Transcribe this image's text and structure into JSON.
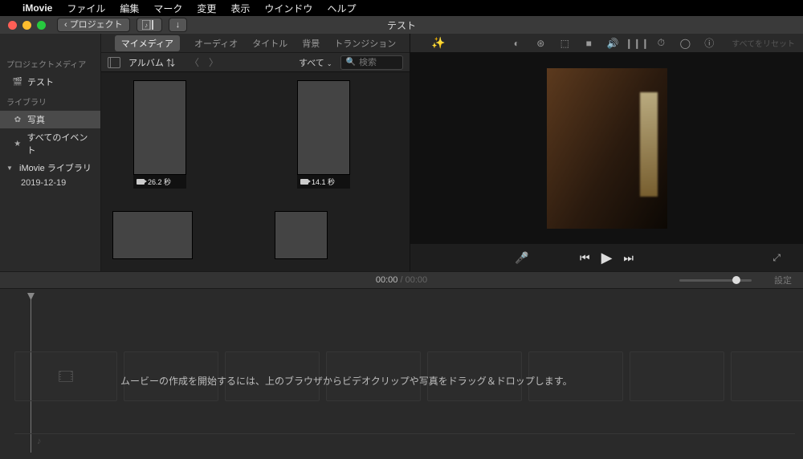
{
  "menubar": {
    "app": "iMovie",
    "items": [
      "ファイル",
      "編集",
      "マーク",
      "変更",
      "表示",
      "ウインドウ",
      "ヘルプ"
    ]
  },
  "titlebar": {
    "back_label": "プロジェクト",
    "title": "テスト"
  },
  "sidebar": {
    "projectmedia_head": "プロジェクトメディア",
    "project_name": "テスト",
    "library_head": "ライブラリ",
    "photos_label": "写真",
    "allevents_label": "すべてのイベント",
    "imovie_library_label": "iMovie ライブラリ",
    "event_date": "2019-12-19"
  },
  "tabs": {
    "items": [
      "マイメディア",
      "オーディオ",
      "タイトル",
      "背景",
      "トランジション"
    ],
    "active_index": 0
  },
  "browser_bar": {
    "album_label": "アルバム",
    "all_label": "すべて",
    "search_placeholder": "検索"
  },
  "clips": [
    {
      "duration": "26.2 秒"
    },
    {
      "duration": "14.1 秒"
    },
    {
      "duration": ""
    },
    {
      "duration": ""
    }
  ],
  "preview": {
    "reset_label": "すべてをリセット"
  },
  "timebar": {
    "current": "00:00",
    "total": "00:00",
    "settings_label": "設定"
  },
  "timeline": {
    "hint": "ムービーの作成を開始するには、上のブラウザからビデオクリップや写真をドラッグ＆ドロップします。"
  }
}
